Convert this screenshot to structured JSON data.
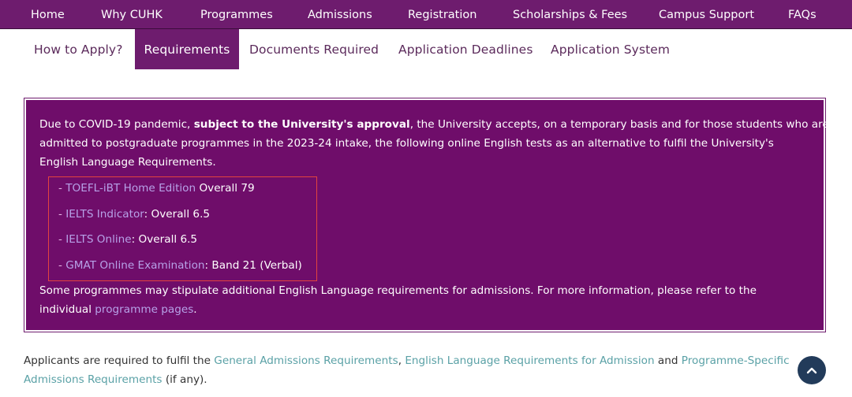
{
  "nav": {
    "items": [
      "Home",
      "Why CUHK",
      "Programmes",
      "Admissions",
      "Registration",
      "Scholarships & Fees",
      "Campus Support",
      "FAQs"
    ]
  },
  "tabs": {
    "items": [
      "How to Apply?",
      "Requirements",
      "Documents Required",
      "Application Deadlines",
      "Application System"
    ],
    "active": "Requirements"
  },
  "notice": {
    "intro_1a": "Due to COVID-19 pandemic, ",
    "intro_1b": "subject to the University's approval",
    "intro_1c": ", the University accepts, on a temporary basis and for those students who are",
    "intro_2": "admitted to postgraduate programmes in the 2023-24 intake, the following online English tests as an alternative to fulfil the University's",
    "intro_3": "English Language Requirements.",
    "tests": [
      {
        "dash": "- ",
        "link": "TOEFL-iBT Home Edition",
        "sep": " ",
        "score": "Overall 79"
      },
      {
        "dash": "- ",
        "link": "IELTS Indicator",
        "sep": ": ",
        "score": "Overall 6.5"
      },
      {
        "dash": "- ",
        "link": "IELTS Online",
        "sep": ": ",
        "score": "Overall 6.5"
      },
      {
        "dash": "- ",
        "link": "GMAT Online Examination",
        "sep": ": ",
        "score": "Band 21 (Verbal)"
      }
    ],
    "outro_1": "Some programmes may stipulate additional English Language requirements for admissions. For more information, please refer to the",
    "outro_2a": "individual ",
    "outro_2_link": "programme pages",
    "outro_2b": "."
  },
  "bottom": {
    "t1": "Applicants are required to fulfil the ",
    "link1": "General Admissions Requirements",
    "t2": ", ",
    "link2": "English Language Requirements for Admission",
    "t3": " and ",
    "link3a": "Programme-Specific",
    "link3b": "Admissions Requirements",
    "t4": " (if any)."
  },
  "colors": {
    "nav_bg": "#6e1c6e",
    "notice_bg": "#6f0d6a",
    "link_in_notice": "#b7a2e8",
    "link_body": "#5aa1a6",
    "highlight_border": "#e3443f"
  }
}
